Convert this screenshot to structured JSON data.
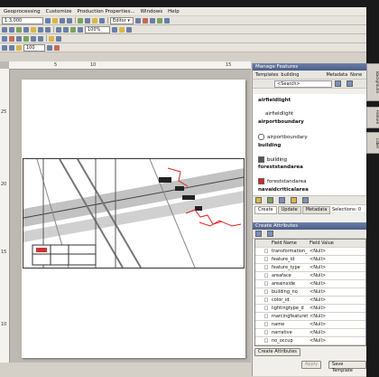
{
  "menu": [
    "Geoprocessing",
    "Customize",
    "Production Properties...",
    "Windows",
    "Help"
  ],
  "toolbar": {
    "scale": "1:3,000",
    "editor": "Editor ▾",
    "zoom": "100%",
    "pct": "100"
  },
  "ruler": {
    "top": [
      "5",
      "10",
      "15"
    ],
    "left": [
      "25",
      "20",
      "15",
      "10"
    ]
  },
  "panel": {
    "title": "Manage Features",
    "tab_templates": "Templates",
    "layer": "building",
    "metadata": "Metadata",
    "none": "None",
    "search_placeholder": "<Search>",
    "items": [
      {
        "name": "airfieldlight",
        "bold": true
      },
      {
        "name": "airfieldlight",
        "bold": false
      },
      {
        "name": "airportboundary",
        "bold": true
      },
      {
        "name": "airportboundary",
        "bold": false
      },
      {
        "name": "building",
        "bold": true
      },
      {
        "name": "building",
        "bold": false
      },
      {
        "name": "foreststandarea",
        "bold": true
      },
      {
        "name": "foreststandarea",
        "bold": false
      },
      {
        "name": "navaidcriticalarea",
        "bold": true
      }
    ],
    "tabs": [
      "Create",
      "Update",
      "Metadata"
    ],
    "selections": "Selections: 0"
  },
  "attributes": {
    "title": "Create Attributes",
    "col_name": "Field Name",
    "col_value": "Field Value",
    "rows": [
      {
        "field": "transformation_",
        "value": "<Null>"
      },
      {
        "field": "feature_id",
        "value": "<Null>"
      },
      {
        "field": "feature_type",
        "value": "<Null>"
      },
      {
        "field": "areaface",
        "value": "<Null>"
      },
      {
        "field": "areainside",
        "value": "<Null>"
      },
      {
        "field": "building_no",
        "value": "<Null>"
      },
      {
        "field": "color_id",
        "value": "<Null>"
      },
      {
        "field": "lightingtype_d",
        "value": "<Null>"
      },
      {
        "field": "marcingfeatureti...",
        "value": "<Null>"
      },
      {
        "field": "name",
        "value": "<Null>"
      },
      {
        "field": "narrative",
        "value": "<Null>"
      },
      {
        "field": "no_occup",
        "value": "<Null>"
      }
    ],
    "create_btn": "Create Attributes",
    "apply_btn": "Apply",
    "save_btn": "Save Template"
  },
  "sidetabs": [
    "Background",
    "Feature",
    "Label"
  ]
}
